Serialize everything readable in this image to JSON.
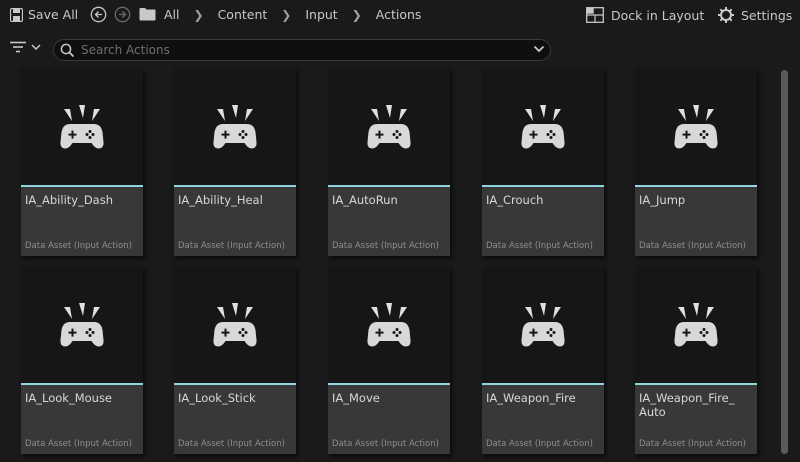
{
  "toolbar": {
    "save_all_label": "Save All",
    "dock_label": "Dock in Layout",
    "settings_label": "Settings"
  },
  "breadcrumb": {
    "items": [
      "All",
      "Content",
      "Input",
      "Actions"
    ]
  },
  "search": {
    "placeholder": "Search Actions",
    "value": ""
  },
  "assets": [
    {
      "name": "IA_Ability_Dash",
      "type": "Data Asset (Input Action)"
    },
    {
      "name": "IA_Ability_Heal",
      "type": "Data Asset (Input Action)"
    },
    {
      "name": "IA_AutoRun",
      "type": "Data Asset (Input Action)"
    },
    {
      "name": "IA_Crouch",
      "type": "Data Asset (Input Action)"
    },
    {
      "name": "IA_Jump",
      "type": "Data Asset (Input Action)"
    },
    {
      "name": "IA_Look_Mouse",
      "type": "Data Asset (Input Action)"
    },
    {
      "name": "IA_Look_Stick",
      "type": "Data Asset (Input Action)"
    },
    {
      "name": "IA_Move",
      "type": "Data Asset (Input Action)"
    },
    {
      "name": "IA_Weapon_Fire",
      "type": "Data Asset (Input Action)"
    },
    {
      "name": "IA_Weapon_Fire_\nAuto",
      "type": "Data Asset (Input Action)"
    }
  ],
  "colors": {
    "accent": "#8fd4df",
    "background": "#1a1a1a",
    "tile_info": "#383838"
  },
  "icons": {
    "save": "save-icon",
    "back": "back-arrow-icon",
    "forward": "forward-arrow-icon",
    "folder": "folder-icon",
    "dock": "dock-layout-icon",
    "settings": "gear-icon",
    "filter": "filter-icon",
    "search": "search-icon",
    "asset": "gamepad-icon"
  }
}
